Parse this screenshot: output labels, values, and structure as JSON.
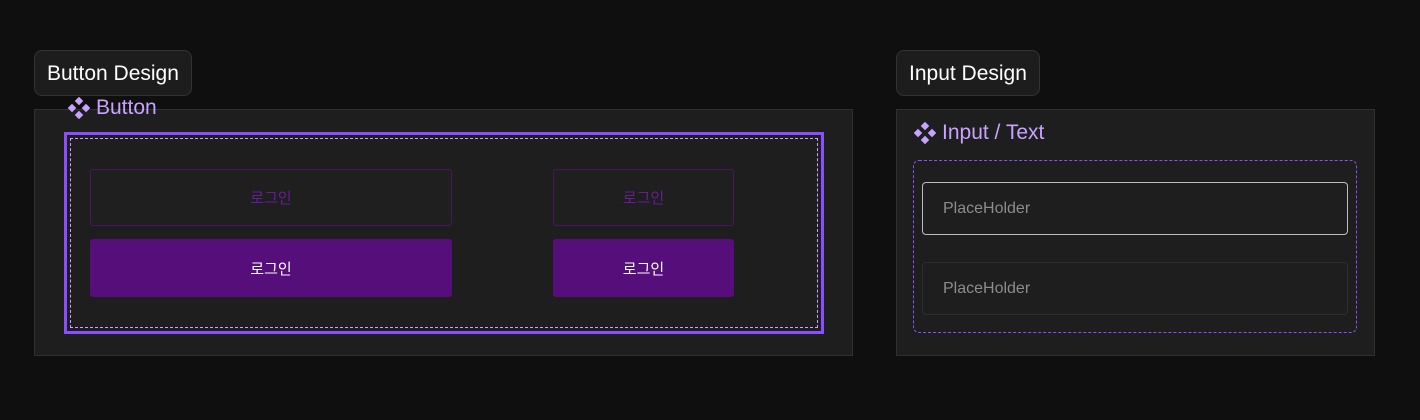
{
  "sections": {
    "button": {
      "title": "Button Design",
      "component_label": "Button",
      "component_icon": "component-diamond-icon",
      "buttons": {
        "wide_outline": "로그인",
        "wide_filled": "로그인",
        "narrow_outline": "로그인",
        "narrow_filled": "로그인"
      }
    },
    "input": {
      "title": "Input Design",
      "component_label": "Input / Text",
      "component_icon": "component-diamond-icon",
      "fields": [
        {
          "placeholder": "PlaceHolder",
          "state": "focused"
        },
        {
          "placeholder": "PlaceHolder",
          "state": "default"
        }
      ]
    }
  },
  "colors": {
    "background": "#0f0f0f",
    "frame": "#1e1e1e",
    "accent": "#8a4dff",
    "label": "#c9a2ff",
    "button_filled": "#560e7a",
    "button_outline_text": "#6a1a9a"
  }
}
